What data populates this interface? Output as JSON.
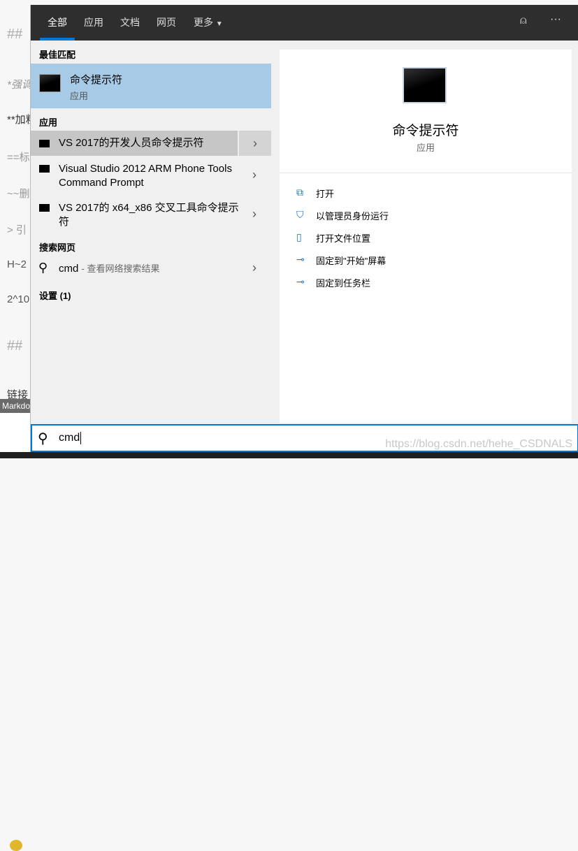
{
  "background": {
    "fragments": [
      "##",
      "*强调",
      "**加粗",
      "==标",
      "~~删",
      "> 引",
      "H~2",
      "2^10",
      "##",
      "链接"
    ],
    "status": "Markdo"
  },
  "header": {
    "tabs": [
      "全部",
      "应用",
      "文档",
      "网页",
      "更多"
    ],
    "active": 0,
    "feedback_icon": "feedback-person-icon",
    "more_icon": "ellipsis-icon"
  },
  "best_match": {
    "heading": "最佳匹配",
    "title": "命令提示符",
    "subtitle": "应用"
  },
  "apps": {
    "heading": "应用",
    "items": [
      "VS 2017的开发人员命令提示符",
      "Visual Studio 2012 ARM Phone Tools Command Prompt",
      "VS 2017的 x64_x86 交叉工具命令提示符"
    ]
  },
  "web": {
    "heading": "搜索网页",
    "query": "cmd",
    "suffix": "- 查看网络搜索结果"
  },
  "settings": {
    "heading": "设置 (1)"
  },
  "detail": {
    "title": "命令提示符",
    "subtitle": "应用",
    "actions": [
      {
        "label": "打开",
        "icon": "open-icon"
      },
      {
        "label": "以管理员身份运行",
        "icon": "shield-icon"
      },
      {
        "label": "打开文件位置",
        "icon": "folder-icon"
      },
      {
        "label": "固定到\"开始\"屏幕",
        "icon": "pin-icon"
      },
      {
        "label": "固定到任务栏",
        "icon": "pin-icon"
      }
    ]
  },
  "search": {
    "value": "cmd"
  },
  "watermark": "https://blog.csdn.net/hehe_CSDNALS",
  "colors": {
    "accent": "#0078d7",
    "selected": "#a7cbe7",
    "header": "#2e2e2e"
  }
}
